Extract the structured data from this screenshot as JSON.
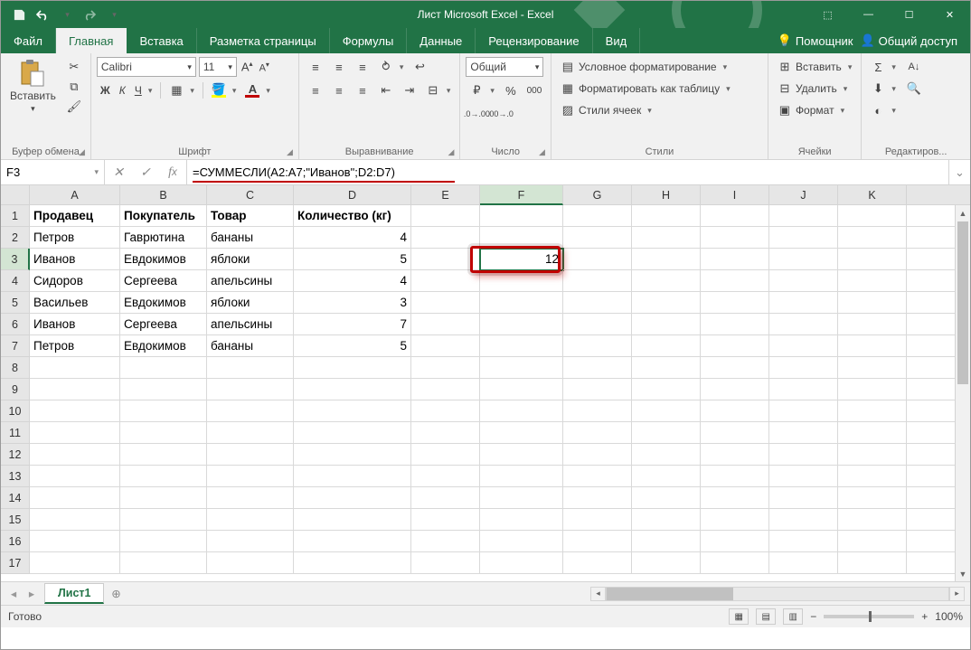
{
  "title": "Лист Microsoft Excel - Excel",
  "tabs": {
    "file": "Файл",
    "home": "Главная",
    "insert": "Вставка",
    "layout": "Разметка страницы",
    "formulas": "Формулы",
    "data": "Данные",
    "review": "Рецензирование",
    "view": "Вид",
    "tell": "Помощник",
    "share": "Общий доступ"
  },
  "ribbon": {
    "clipboard": {
      "label": "Буфер обмена",
      "paste": "Вставить"
    },
    "font": {
      "label": "Шрифт",
      "name": "Calibri",
      "size": "11",
      "bold": "Ж",
      "italic": "К",
      "underline": "Ч"
    },
    "alignment": {
      "label": "Выравнивание"
    },
    "number": {
      "label": "Число",
      "format": "Общий"
    },
    "styles": {
      "label": "Стили",
      "cond": "Условное форматирование",
      "table": "Форматировать как таблицу",
      "cell": "Стили ячеек"
    },
    "cells": {
      "label": "Ячейки",
      "insert": "Вставить",
      "delete": "Удалить",
      "format": "Формат"
    },
    "editing": {
      "label": "Редактиров..."
    }
  },
  "namebox": "F3",
  "formula": "=СУММЕСЛИ(A2:A7;\"Иванов\";D2:D7)",
  "columns": [
    "A",
    "B",
    "C",
    "D",
    "E",
    "F",
    "G",
    "H",
    "I",
    "J",
    "K"
  ],
  "rows_shown": 17,
  "headers": {
    "a": "Продавец",
    "b": "Покупатель",
    "c": "Товар",
    "d": "Количество (кг)"
  },
  "data_rows": [
    {
      "a": "Петров",
      "b": "Гаврютина",
      "c": "бананы",
      "d": "4"
    },
    {
      "a": "Иванов",
      "b": "Евдокимов",
      "c": "яблоки",
      "d": "5"
    },
    {
      "a": "Сидоров",
      "b": "Сергеева",
      "c": "апельсины",
      "d": "4"
    },
    {
      "a": "Васильев",
      "b": "Евдокимов",
      "c": "яблоки",
      "d": "3"
    },
    {
      "a": "Иванов",
      "b": "Сергеева",
      "c": "апельсины",
      "d": "7"
    },
    {
      "a": "Петров",
      "b": "Евдокимов",
      "c": "бананы",
      "d": "5"
    }
  ],
  "active_cell": {
    "col": "F",
    "row": 3,
    "value": "12"
  },
  "sheet": {
    "name": "Лист1"
  },
  "status": {
    "ready": "Готово",
    "zoom": "100%"
  }
}
